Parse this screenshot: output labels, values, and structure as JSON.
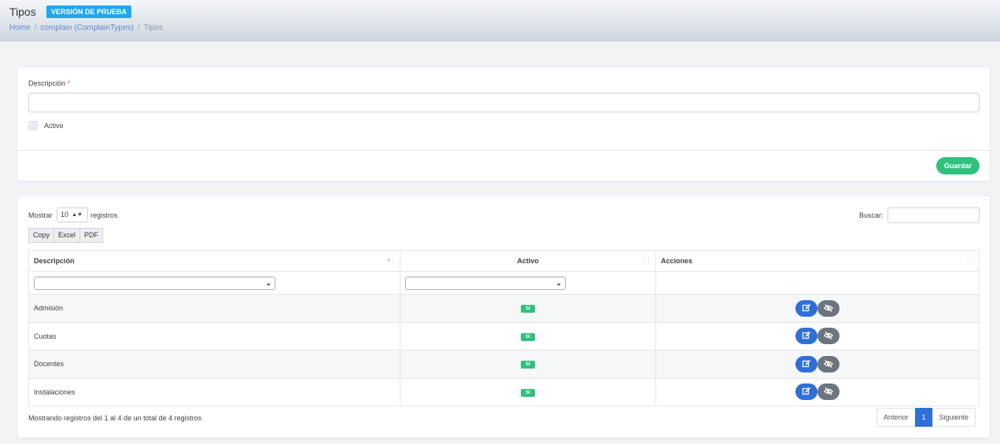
{
  "header": {
    "title": "Tipos",
    "badge": "VERSIÓN DE PRUEBA",
    "breadcrumb": [
      "Home",
      "complain (ComplainTypes)",
      "Tipos"
    ]
  },
  "form": {
    "description_label": "Descripción",
    "required_mark": "*",
    "description_value": "",
    "active_label": "Activo",
    "active_checked": false,
    "save_label": "Guardar"
  },
  "table_controls": {
    "show_label": "Mostrar",
    "page_size": "10",
    "records_label": "registros",
    "search_label": "Buscar:",
    "search_value": "",
    "export_buttons": [
      "Copy",
      "Excel",
      "PDF"
    ]
  },
  "table": {
    "columns": [
      "Descripción",
      "Activo",
      "Acciones"
    ],
    "rows": [
      {
        "descripcion": "Admisión",
        "activo": "SI"
      },
      {
        "descripcion": "Cuotas",
        "activo": "SI"
      },
      {
        "descripcion": "Docentes",
        "activo": "SI"
      },
      {
        "descripcion": "Instalaciones",
        "activo": "SI"
      }
    ]
  },
  "footer": {
    "info": "Mostrando registros del 1 al 4 de un total de 4 registros",
    "prev": "Anterior",
    "page": "1",
    "next": "Siguiente"
  },
  "colors": {
    "accent": "#2f6fd8",
    "success": "#2ec27e",
    "badge": "#1ea7ec",
    "secondary": "#6c757d"
  }
}
